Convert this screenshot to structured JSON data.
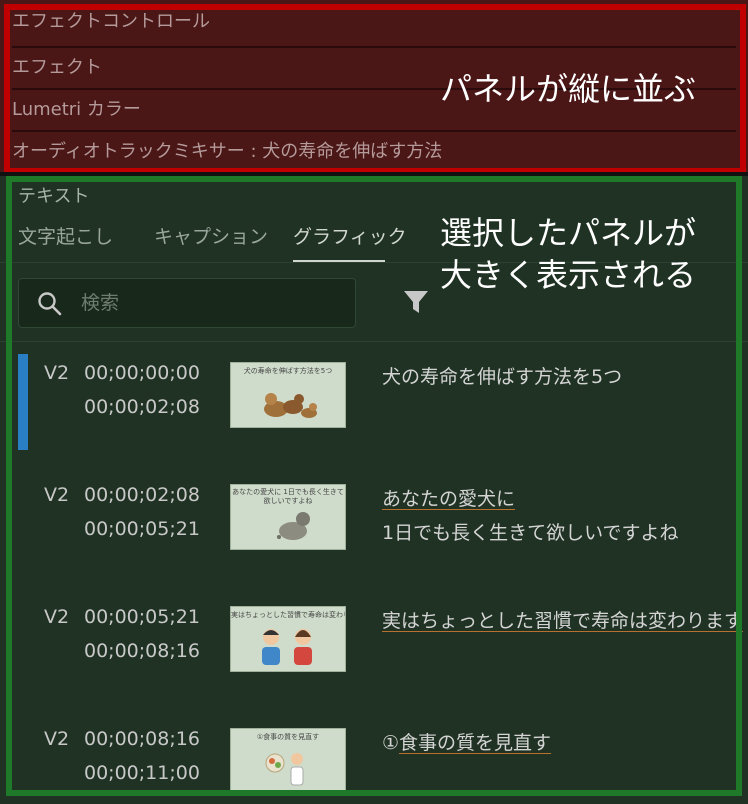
{
  "top_panels": {
    "rows": [
      "エフェクトコントロール",
      "エフェクト",
      "Lumetri カラー",
      "オーディオトラックミキサー : 犬の寿命を伸ばす方法"
    ],
    "annotation": "パネルが縦に並ぶ"
  },
  "text_panel": {
    "title": "テキスト",
    "tabs": [
      "文字起こし",
      "キャプション",
      "グラフィック"
    ],
    "active_tab": "グラフィック",
    "search_placeholder": "検索",
    "annotation_line1": "選択したパネルが",
    "annotation_line2": "大きく表示される",
    "items": [
      {
        "track": "V2",
        "start": "00;00;00;00",
        "end": "00;00;02;08",
        "thumb_caption": "犬の寿命を伸ばす方法を5つ",
        "line1": "犬の寿命を伸ばす方法を5つ",
        "line2": ""
      },
      {
        "track": "V2",
        "start": "00;00;02;08",
        "end": "00;00;05;21",
        "thumb_caption": "あなたの愛犬に 1日でも長く生きて欲しいですよね",
        "line1": "あなたの愛犬に",
        "line2": "1日でも長く生きて欲しいですよね"
      },
      {
        "track": "V2",
        "start": "00;00;05;21",
        "end": "00;00;08;16",
        "thumb_caption": "実はちょっとした習慣で寿命は変わります",
        "line1": "実はちょっとした習慣で寿命は変わります",
        "line2": ""
      },
      {
        "track": "V2",
        "start": "00;00;08;16",
        "end": "00;00;11;00",
        "thumb_caption": "①食事の質を見直す",
        "line1_prefix": "①",
        "line1_rest": "食事の質を見直す",
        "line2": ""
      }
    ]
  },
  "colors": {
    "selection_marker": "#2a7fc4",
    "red_frame": "#c00000",
    "green_frame": "#1e7a28",
    "underline": "#b8702e"
  }
}
